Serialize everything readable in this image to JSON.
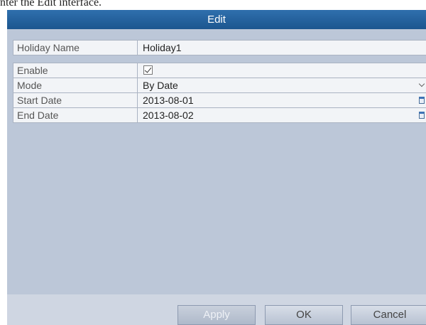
{
  "caption": "nter the Edit interface.",
  "dialog": {
    "title": "Edit",
    "fields": {
      "holiday_name": {
        "label": "Holiday Name",
        "value": "Holiday1"
      },
      "enable": {
        "label": "Enable",
        "checked": true
      },
      "mode": {
        "label": "Mode",
        "value": "By Date"
      },
      "start_date": {
        "label": "Start Date",
        "value": "2013-08-01"
      },
      "end_date": {
        "label": "End Date",
        "value": "2013-08-02"
      }
    },
    "buttons": {
      "apply": "Apply",
      "ok": "OK",
      "cancel": "Cancel"
    }
  }
}
